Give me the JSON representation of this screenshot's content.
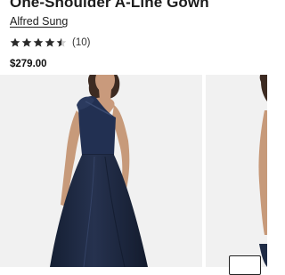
{
  "product": {
    "title": "One-Shoulder A-Line Gown",
    "brand": "Alfred Sung",
    "rating": 4.5,
    "rating_max": 5,
    "review_count": "(10)",
    "price": "$279.00"
  },
  "gallery": {
    "images": [
      {
        "depicts": "navy one-shoulder gown front"
      },
      {
        "depicts": "gown alternate view"
      }
    ],
    "button_icon": "expand-icon"
  },
  "colors": {
    "gown": "#1f2b45",
    "photo_background": "#f1f1f1",
    "star": "#2a2a2a"
  }
}
